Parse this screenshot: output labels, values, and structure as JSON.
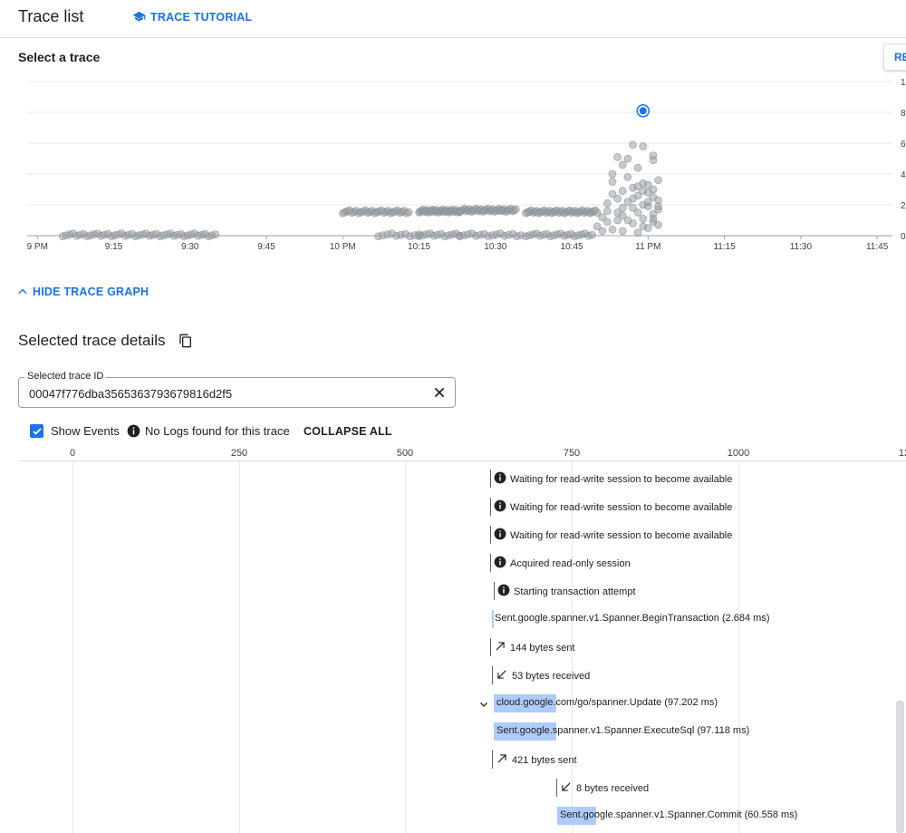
{
  "header": {
    "title": "Trace list",
    "tutorial_label": "TRACE TUTORIAL"
  },
  "graph_section": {
    "label": "Select a trace",
    "reset_label": "RE",
    "hide_label": "HIDE TRACE GRAPH"
  },
  "chart_data": {
    "type": "scatter",
    "x_tick_labels": [
      "9 PM",
      "9:15",
      "9:30",
      "9:45",
      "10 PM",
      "10:15",
      "10:30",
      "10:45",
      "11 PM",
      "11:15",
      "11:30",
      "11:45"
    ],
    "y_tick_labels": [
      "1",
      "8",
      "6",
      "4",
      "2",
      "0"
    ],
    "x_unit": "minutes after 9 PM",
    "xlim": [
      -2,
      168
    ],
    "ylim": [
      0,
      10
    ],
    "grid": true,
    "series": [
      {
        "color": "#9aa0a6",
        "clusters": [
          {
            "x_range": [
              5,
              35
            ],
            "y": 0.05,
            "count": 45
          },
          {
            "x_range": [
              60,
              73
            ],
            "y": 1.55,
            "count": 30
          },
          {
            "x_range": [
              67,
              75
            ],
            "y": 0.05,
            "count": 10
          },
          {
            "x_range": [
              75,
              83
            ],
            "y": 1.6,
            "count": 30
          },
          {
            "x_range": [
              75,
              83
            ],
            "y": 0.05,
            "count": 12
          },
          {
            "x_range": [
              83,
              94
            ],
            "y": 1.65,
            "count": 35
          },
          {
            "x_range": [
              83,
              95
            ],
            "y": 0.05,
            "count": 16
          },
          {
            "x_range": [
              96,
              110
            ],
            "y": 1.55,
            "count": 40
          },
          {
            "x_range": [
              96,
              109
            ],
            "y": 0.05,
            "count": 20
          }
        ]
      },
      {
        "color": "#9aa0a6",
        "scatter": [
          [
            110,
            0.6
          ],
          [
            111,
            1.2
          ],
          [
            112,
            1.6
          ],
          [
            112,
            2.1
          ],
          [
            113,
            0.4
          ],
          [
            113,
            3.5
          ],
          [
            113,
            4.0
          ],
          [
            114,
            2.4
          ],
          [
            114,
            1.0
          ],
          [
            114,
            5.1
          ],
          [
            115,
            2.9
          ],
          [
            115,
            1.3
          ],
          [
            115,
            0.3
          ],
          [
            115,
            4.6
          ],
          [
            116,
            3.8
          ],
          [
            116,
            2.2
          ],
          [
            116,
            5.0
          ],
          [
            117,
            1.8
          ],
          [
            117,
            3.1
          ],
          [
            117,
            0.8
          ],
          [
            118,
            2.6
          ],
          [
            118,
            1.5
          ],
          [
            118,
            0.2
          ],
          [
            118,
            4.4
          ],
          [
            119,
            3.4
          ],
          [
            119,
            2.0
          ],
          [
            119,
            1.1
          ],
          [
            119,
            5.8
          ],
          [
            120,
            2.8
          ],
          [
            120,
            1.9
          ],
          [
            120,
            0.5
          ],
          [
            120,
            3.3
          ],
          [
            121,
            4.9
          ],
          [
            121,
            1.4
          ],
          [
            121,
            2.5
          ],
          [
            121,
            0.9
          ],
          [
            121,
            3.0
          ],
          [
            121,
            5.2
          ],
          [
            122,
            2.3
          ],
          [
            122,
            0.7
          ],
          [
            122,
            1.7
          ],
          [
            122,
            3.6
          ],
          [
            117,
            5.9
          ],
          [
            116,
            1.0
          ],
          [
            114,
            1.5
          ],
          [
            113,
            2.7
          ],
          [
            119,
            2.9
          ],
          [
            120,
            2.2
          ],
          [
            118,
            3.2
          ],
          [
            115,
            1.8
          ],
          [
            112,
            0.9
          ],
          [
            111,
            0.3
          ],
          [
            121,
            1.1
          ],
          [
            122,
            1.9
          ],
          [
            117,
            2.4
          ],
          [
            119,
            0.6
          ]
        ]
      },
      {
        "name": "selected",
        "color": "#1a73e8",
        "points": [
          [
            119,
            8.1
          ]
        ]
      }
    ]
  },
  "details": {
    "title": "Selected trace details",
    "trace_id_label": "Selected trace ID",
    "trace_id_value": "00047f776dba3565363793679816d2f5",
    "show_events_label": "Show Events",
    "no_logs_label": "No Logs found for this trace",
    "collapse_all_label": "COLLAPSE ALL"
  },
  "waterfall": {
    "axis_labels": [
      "0",
      "250",
      "500",
      "750",
      "1000",
      "12"
    ],
    "rows": [
      {
        "kind": "event",
        "icon": "info-icon",
        "text": "Waiting for read-write session to become available"
      },
      {
        "kind": "event",
        "icon": "info-icon",
        "text": "Waiting for read-write session to become available"
      },
      {
        "kind": "event",
        "icon": "info-icon",
        "text": "Waiting for read-write session to become available"
      },
      {
        "kind": "event",
        "icon": "info-icon",
        "text": "Acquired read-only session"
      },
      {
        "kind": "event",
        "icon": "info-icon",
        "text": "Starting transaction attempt"
      },
      {
        "kind": "span",
        "text": "Sent.google.spanner.v1.Spanner.BeginTransaction (2.684 ms)"
      },
      {
        "kind": "event",
        "icon": "arrow-sent-icon",
        "text": "144 bytes sent"
      },
      {
        "kind": "event",
        "icon": "arrow-received-icon",
        "text": "53 bytes received"
      },
      {
        "kind": "span",
        "text": "cloud.google.com/go/spanner.Update (97.202 ms)"
      },
      {
        "kind": "span",
        "text": "Sent.google.spanner.v1.Spanner.ExecuteSql (97.118 ms)"
      },
      {
        "kind": "event",
        "icon": "arrow-sent-icon",
        "text": "421 bytes sent"
      },
      {
        "kind": "event",
        "icon": "arrow-received-icon",
        "text": "8 bytes received"
      },
      {
        "kind": "span",
        "text": "Sent.google.spanner.v1.Spanner.Commit (60.558 ms)"
      }
    ]
  }
}
